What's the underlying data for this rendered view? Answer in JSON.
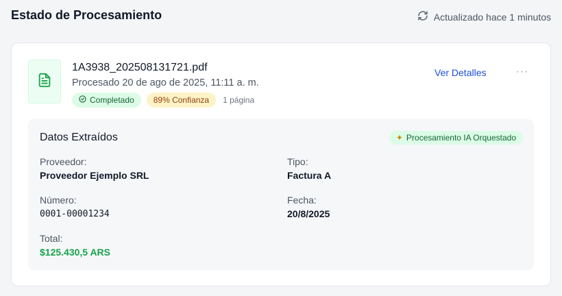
{
  "header": {
    "title": "Estado de Procesamiento",
    "refresh_text": "Actualizado hace 1 minutos"
  },
  "document": {
    "file_name": "1A3938_202508131721.pdf",
    "processed_text": "Procesado 20 de ago de 2025, 11:11 a. m.",
    "status_badge": "Completado",
    "confidence_badge": "89% Confianza",
    "pages": "1 página",
    "details_link": "Ver Detalles",
    "more_menu": "···"
  },
  "extracted": {
    "title": "Datos Extraídos",
    "ai_badge": "Procesamiento IA Orquestado",
    "fields": {
      "provider_label": "Proveedor:",
      "provider_value": "Proveedor Ejemplo SRL",
      "type_label": "Tipo:",
      "type_value": "Factura A",
      "number_label": "Número:",
      "number_value": "0001-00001234",
      "date_label": "Fecha:",
      "date_value": "20/8/2025",
      "total_label": "Total:",
      "total_value": "$125.430,5 ARS"
    }
  },
  "colors": {
    "success": "#16a34a",
    "link": "#1d4ed8",
    "warning_bg": "#fef3c7"
  },
  "icons": [
    "refresh-icon",
    "file-text-icon",
    "check-circle-icon",
    "sparkle-icon",
    "more-horizontal-icon"
  ]
}
